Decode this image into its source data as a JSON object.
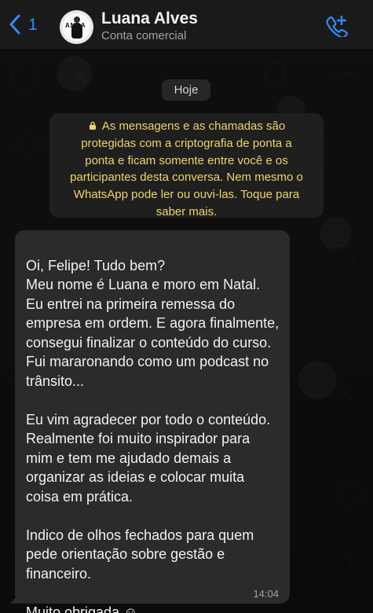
{
  "header": {
    "back_count": "1",
    "contact_name": "Luana Alves",
    "contact_subtitle": "Conta comercial",
    "avatar_text": "ANCA"
  },
  "chat": {
    "date_label": "Hoje",
    "encryption_notice": "As mensagens e as chamadas são protegidas com a criptografia de ponta a ponta e ficam somente entre você e os participantes desta conversa. Nem mesmo o WhatsApp pode ler ou ouvi-las. Toque para saber mais.",
    "message": {
      "text": "Oi, Felipe! Tudo bem?\nMeu nome é Luana e moro em Natal. Eu entrei na primeira remessa do empresa em ordem. E agora finalmente, consegui finalizar o conteúdo do curso. Fui mararonando como um podcast no trânsito...\n\nEu vim agradecer por todo o conteúdo. Realmente foi muito inspirador para mim e tem me ajudado demais a organizar as ideias e colocar muita coisa em prática.\n\nIndico de olhos fechados para quem pede orientação sobre gestão e financeiro.\n\nMuito obrigada ☺",
      "time": "14:04"
    }
  },
  "colors": {
    "accent": "#2f8cff",
    "notice_text": "#f0d36a",
    "incoming_bubble": "#2b2b2b",
    "header_background": "#1a1a1a"
  },
  "icons": {
    "back": "chevron-left-icon",
    "add_call": "phone-plus-icon",
    "notice": "lock-icon"
  }
}
